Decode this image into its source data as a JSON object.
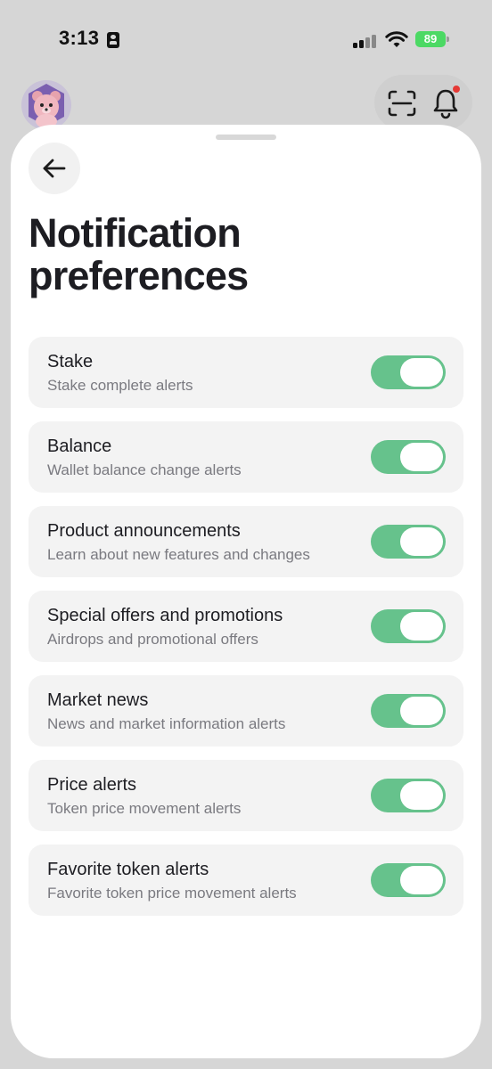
{
  "status_bar": {
    "time": "3:13",
    "battery": "89",
    "icons": [
      "id-badge-icon",
      "signal-icon",
      "wifi-icon",
      "battery-charging-icon"
    ]
  },
  "header": {
    "icons": [
      "avatar",
      "scan-icon",
      "bell-icon"
    ],
    "bell_dot_color": "#e53935"
  },
  "sheet": {
    "title": "Notification preferences",
    "back_icon": "arrow-left-icon"
  },
  "preferences": [
    {
      "title": "Stake",
      "description": "Stake complete alerts",
      "enabled": true
    },
    {
      "title": "Balance",
      "description": "Wallet balance change alerts",
      "enabled": true
    },
    {
      "title": "Product announcements",
      "description": "Learn about new features and changes",
      "enabled": true
    },
    {
      "title": "Special offers and promotions",
      "description": "Airdrops and promotional offers",
      "enabled": true
    },
    {
      "title": "Market news",
      "description": "News and market information alerts",
      "enabled": true
    },
    {
      "title": "Price alerts",
      "description": "Token price movement alerts",
      "enabled": true
    },
    {
      "title": "Favorite token alerts",
      "description": "Favorite token price movement alerts",
      "enabled": true
    }
  ],
  "colors": {
    "toggle_on": "#66c28c",
    "battery": "#4cd964",
    "item_bg": "#f3f3f3"
  }
}
